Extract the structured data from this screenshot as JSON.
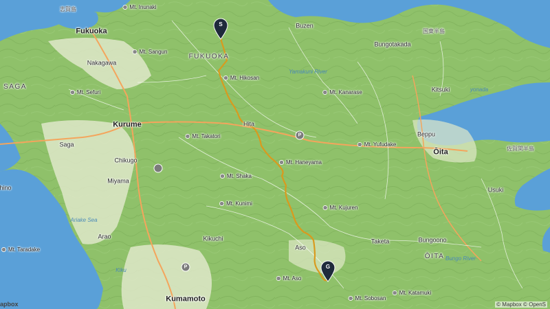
{
  "map": {
    "logo": "apbox",
    "attribution": "© Mapbox © OpenS",
    "route_color": "#d99a1e",
    "land_color": "#8fc16a",
    "water_color": "#5aa0d8",
    "lowland_color": "#dfe8c9"
  },
  "markers": {
    "start": "S",
    "goal": "G"
  },
  "labels": {
    "fukuoka": "Fukuoka",
    "nakagawa": "Nakagawa",
    "kurume": "Kurume",
    "saga_city": "Saga",
    "chikugo": "Chikugo",
    "miyama": "Miyama",
    "arao": "Arao",
    "kikuchi": "Kikuchi",
    "kumamoto": "Kumamoto",
    "hita": "Hita",
    "aso": "Aso",
    "taketa": "Taketa",
    "bungoono": "Bungoono",
    "usuki": "Usuki",
    "oita": "Ōita",
    "beppu": "Beppu",
    "kitsuki": "Kitsuki",
    "buzen": "Buzen",
    "bungotakada": "Bungotakada",
    "fukuoka_pref": "FUKUOKA",
    "saga_pref": "SAGA",
    "oita_pref": "ŌITA",
    "ariake_sea": "Ariake Sea",
    "yamakuni_river": "Yamakuni River",
    "yonada": "yonada",
    "bungo_river": "Bungo River",
    "hino": "hino",
    "kiku": "Kiku",
    "jp_1": "志賀島",
    "jp_2": "国東半島",
    "jp_3": "佐賀関半島",
    "mt_inunaki": "Mt. Inunaki",
    "mt_sangun": "Mt. Sangun",
    "mt_sefuri": "Mt. Sefuri",
    "mt_hikosan": "Mt. Hikosan",
    "mt_kanarase": "Mt. Kanarase",
    "mt_takatori": "Mt. Takatori",
    "mt_haneyama": "Mt. Haneyama",
    "mt_yufudake": "Mt. Yufudake",
    "mt_shaka": "Mt. Shaka",
    "mt_kunimi": "Mt. Kunimi",
    "mt_kujuren": "Mt. Kujuren",
    "mt_aso": "Mt. Aso",
    "mt_sobosan": "Mt. Sobosan",
    "mt_katamuki": "Mt. Katamuki",
    "mt_tara": "Mt. Taradake"
  }
}
